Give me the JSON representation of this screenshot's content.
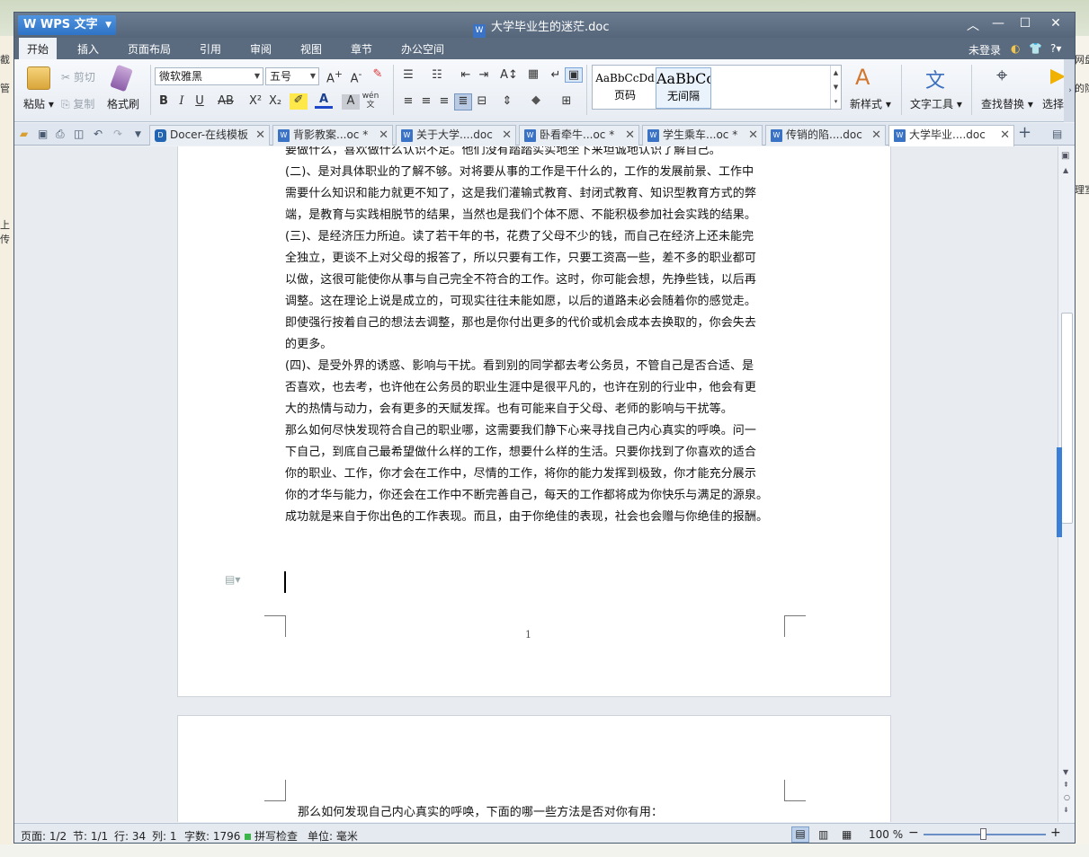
{
  "app": {
    "name": "WPS 文字",
    "doc_title": "大学毕业生的迷茫.doc"
  },
  "menu": {
    "items": [
      "开始",
      "插入",
      "页面布局",
      "引用",
      "审阅",
      "视图",
      "章节",
      "办公空间"
    ],
    "login": "未登录",
    "help": "?"
  },
  "ribbon": {
    "paste": "粘贴",
    "cut": "剪切",
    "copy": "复制",
    "format_painter": "格式刷",
    "font_name": "微软雅黑",
    "font_size": "五号",
    "bold": "B",
    "italic": "I",
    "underline": "U",
    "strike": "AB",
    "superscript": "X²",
    "subscript": "X₂",
    "wen": "wén",
    "style_1_sample": "AaBbCcDd",
    "style_1_name": "页码",
    "style_2_sample": "AaBbCc",
    "style_2_name": "无间隔",
    "new_style": "新样式",
    "text_tools": "文字工具",
    "find_replace": "查找替换",
    "select": "选择"
  },
  "tabs": [
    {
      "label": "Docer-在线模板",
      "icon": "docer-icon"
    },
    {
      "label": "背影教案...oc *",
      "icon": "w"
    },
    {
      "label": "关于大学....doc",
      "icon": "w"
    },
    {
      "label": "卧看牵牛...oc *",
      "icon": "w"
    },
    {
      "label": "学生乘车...oc *",
      "icon": "w"
    },
    {
      "label": "传销的陷....doc",
      "icon": "w"
    },
    {
      "label": "大学毕业....doc",
      "icon": "w",
      "active": true
    }
  ],
  "document": {
    "page1_lines": [
      "要做什么，喜欢做什么认识不足。他们没有踏踏实实地坐下来坦诚地认识了解自己。",
      "(二)、是对具体职业的了解不够。对将要从事的工作是干什么的，工作的发展前景、工作中",
      "需要什么知识和能力就更不知了，这是我们灌输式教育、封闭式教育、知识型教育方式的弊",
      "端，是教育与实践相脱节的结果，当然也是我们个体不愿、不能积极参加社会实践的结果。",
      "(三)、是经济压力所迫。读了若干年的书，花费了父母不少的钱，而自己在经济上还未能完",
      "全独立，更谈不上对父母的报答了，所以只要有工作，只要工资高一些，差不多的职业都可",
      "以做，这很可能使你从事与自己完全不符合的工作。这时，你可能会想，先挣些钱，以后再",
      "调整。这在理论上说是成立的，可现实往往未能如愿，以后的道路未必会随着你的感觉走。",
      "即使强行按着自己的想法去调整，那也是你付出更多的代价或机会成本去换取的，你会失去",
      "的更多。",
      "(四)、是受外界的诱惑、影响与干扰。看到别的同学都去考公务员，不管自己是否合适、是",
      "否喜欢，也去考，也许他在公务员的职业生涯中是很平凡的，也许在别的行业中，他会有更",
      "大的热情与动力，会有更多的天赋发挥。也有可能来自于父母、老师的影响与干扰等。",
      "那么如何尽快发现符合自己的职业哪，这需要我们静下心来寻找自己内心真实的呼唤。问一",
      "下自己，到底自己最希望做什么样的工作，想要什么样的生活。只要你找到了你喜欢的适合",
      "你的职业、工作，你才会在工作中，尽情的工作，将你的能力发挥到极致，你才能充分展示",
      "你的才华与能力，你还会在工作中不断完善自己，每天的工作都将成为你快乐与满足的源泉。",
      "成功就是来自于你出色的工作表现。而且，由于你绝佳的表现，社会也会赠与你绝佳的报酬。"
    ],
    "page_number": "1",
    "page2_line": "那么如何发现自己内心真实的呼唤，下面的哪一些方法是否对你有用："
  },
  "status": {
    "page": "页面: 1/2",
    "section": "节: 1/1",
    "row": "行: 34",
    "col": "列: 1",
    "words": "字数: 1796",
    "spell": "拼写检查",
    "unit": "单位: 毫米",
    "zoom": "100 %",
    "zoom_level": 1.0
  },
  "background": {
    "left_texts": [
      "截",
      "管",
      "上传"
    ],
    "right_texts": [
      "网盘",
      "的隐",
      "理室"
    ]
  },
  "colors": {
    "titlebar": "#5e6e83",
    "accent": "#2f73c6"
  }
}
